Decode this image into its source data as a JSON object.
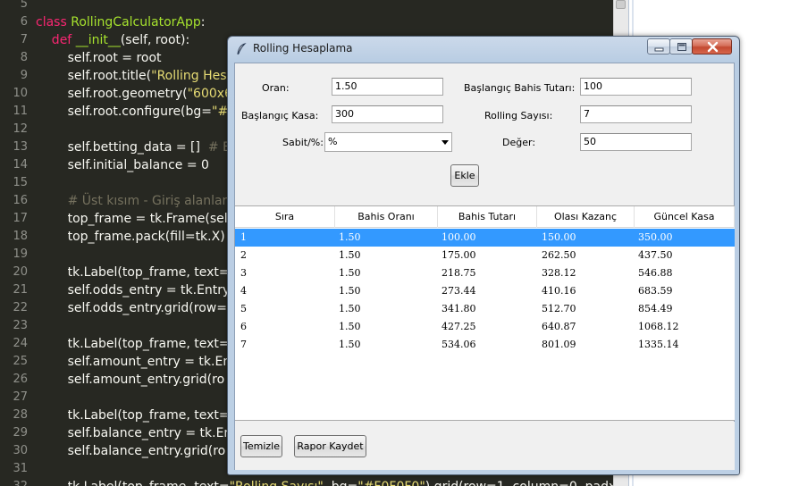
{
  "editor": {
    "lines": [
      {
        "n": "5",
        "parts": [
          {
            "t": "",
            "c": "pl"
          }
        ]
      },
      {
        "n": "6",
        "parts": [
          {
            "t": "class ",
            "c": "kw"
          },
          {
            "t": "RollingCalculatorApp",
            "c": "cls"
          },
          {
            "t": ":",
            "c": "pl"
          }
        ]
      },
      {
        "n": "7",
        "parts": [
          {
            "t": "    def ",
            "c": "kw"
          },
          {
            "t": "__init__",
            "c": "cls"
          },
          {
            "t": "(self, root):",
            "c": "pl"
          }
        ]
      },
      {
        "n": "8",
        "parts": [
          {
            "t": "        self.root = root",
            "c": "pl"
          }
        ]
      },
      {
        "n": "9",
        "parts": [
          {
            "t": "        self.root.title(",
            "c": "pl"
          },
          {
            "t": "\"Rolling Hesa",
            "c": "str"
          }
        ]
      },
      {
        "n": "10",
        "parts": [
          {
            "t": "        self.root.geometry(",
            "c": "pl"
          },
          {
            "t": "\"600x6",
            "c": "str"
          }
        ]
      },
      {
        "n": "11",
        "parts": [
          {
            "t": "        self.root.configure(bg=",
            "c": "pl"
          },
          {
            "t": "\"#",
            "c": "str"
          }
        ]
      },
      {
        "n": "12",
        "parts": [
          {
            "t": "",
            "c": "pl"
          }
        ]
      },
      {
        "n": "13",
        "parts": [
          {
            "t": "        self.betting_data = []  ",
            "c": "pl"
          },
          {
            "t": "# B",
            "c": "cm"
          }
        ]
      },
      {
        "n": "14",
        "parts": [
          {
            "t": "        self.initial_balance = 0",
            "c": "pl"
          }
        ]
      },
      {
        "n": "15",
        "parts": [
          {
            "t": "",
            "c": "pl"
          }
        ]
      },
      {
        "n": "16",
        "parts": [
          {
            "t": "        # Üst kısım - Giriş alanları",
            "c": "cm"
          }
        ]
      },
      {
        "n": "17",
        "parts": [
          {
            "t": "        top_frame = tk.Frame(self",
            "c": "pl"
          }
        ]
      },
      {
        "n": "18",
        "parts": [
          {
            "t": "        top_frame.pack(fill=tk.X)",
            "c": "pl"
          }
        ]
      },
      {
        "n": "19",
        "parts": [
          {
            "t": "",
            "c": "pl"
          }
        ]
      },
      {
        "n": "20",
        "parts": [
          {
            "t": "        tk.Label(top_frame, text=",
            "c": "pl"
          }
        ]
      },
      {
        "n": "21",
        "parts": [
          {
            "t": "        self.odds_entry = tk.Entry(",
            "c": "pl"
          }
        ]
      },
      {
        "n": "22",
        "parts": [
          {
            "t": "        self.odds_entry.grid(row=",
            "c": "pl"
          }
        ]
      },
      {
        "n": "23",
        "parts": [
          {
            "t": "",
            "c": "pl"
          }
        ]
      },
      {
        "n": "24",
        "parts": [
          {
            "t": "        tk.Label(top_frame, text=",
            "c": "pl"
          }
        ]
      },
      {
        "n": "25",
        "parts": [
          {
            "t": "        self.amount_entry = tk.Ent",
            "c": "pl"
          }
        ]
      },
      {
        "n": "26",
        "parts": [
          {
            "t": "        self.amount_entry.grid(ro",
            "c": "pl"
          }
        ]
      },
      {
        "n": "27",
        "parts": [
          {
            "t": "",
            "c": "pl"
          }
        ]
      },
      {
        "n": "28",
        "parts": [
          {
            "t": "        tk.Label(top_frame, text=",
            "c": "pl"
          }
        ]
      },
      {
        "n": "29",
        "parts": [
          {
            "t": "        self.balance_entry = tk.Er",
            "c": "pl"
          }
        ]
      },
      {
        "n": "30",
        "parts": [
          {
            "t": "        self.balance_entry.grid(ro",
            "c": "pl"
          }
        ]
      },
      {
        "n": "31",
        "parts": [
          {
            "t": "",
            "c": "pl"
          }
        ]
      },
      {
        "n": "32",
        "parts": [
          {
            "t": "        tk.Label(top_frame, text=",
            "c": "pl"
          },
          {
            "t": "\"Rolling Sayısı\"",
            "c": "str"
          },
          {
            "t": ", bg=",
            "c": "pl"
          },
          {
            "t": "\"#F0F0F0\"",
            "c": "str"
          },
          {
            "t": ").grid(row=1, column=0, padx",
            "c": "pl"
          }
        ]
      }
    ]
  },
  "window": {
    "title": "Rolling Hesaplama",
    "form": {
      "odds_label": "Oran:",
      "odds_value": "1.50",
      "start_bet_label": "Başlangıç Bahis Tutarı:",
      "start_bet_value": "100",
      "start_balance_label": "Başlangıç Kasa:",
      "start_balance_value": "300",
      "rolling_count_label": "Rolling Sayısı:",
      "rolling_count_value": "7",
      "fixed_pct_label": "Sabit/%:",
      "fixed_pct_value": "%",
      "value_label": "Değer:",
      "value_value": "50",
      "add_button": "Ekle"
    },
    "table": {
      "columns": [
        "Sıra",
        "Bahis Oranı",
        "Bahis Tutarı",
        "Olası Kazanç",
        "Güncel Kasa"
      ],
      "rows": [
        [
          "1",
          "1.50",
          "100.00",
          "150.00",
          "350.00"
        ],
        [
          "2",
          "1.50",
          "175.00",
          "262.50",
          "437.50"
        ],
        [
          "3",
          "1.50",
          "218.75",
          "328.12",
          "546.88"
        ],
        [
          "4",
          "1.50",
          "273.44",
          "410.16",
          "683.59"
        ],
        [
          "5",
          "1.50",
          "341.80",
          "512.70",
          "854.49"
        ],
        [
          "6",
          "1.50",
          "427.25",
          "640.87",
          "1068.12"
        ],
        [
          "7",
          "1.50",
          "534.06",
          "801.09",
          "1335.14"
        ]
      ],
      "selected_row": 0
    },
    "clear_button": "Temizle",
    "save_report_button": "Rapor Kaydet"
  },
  "colors": {
    "editor_bg": "#272822",
    "selection": "#3399ff",
    "close_button": "#c75a43"
  }
}
